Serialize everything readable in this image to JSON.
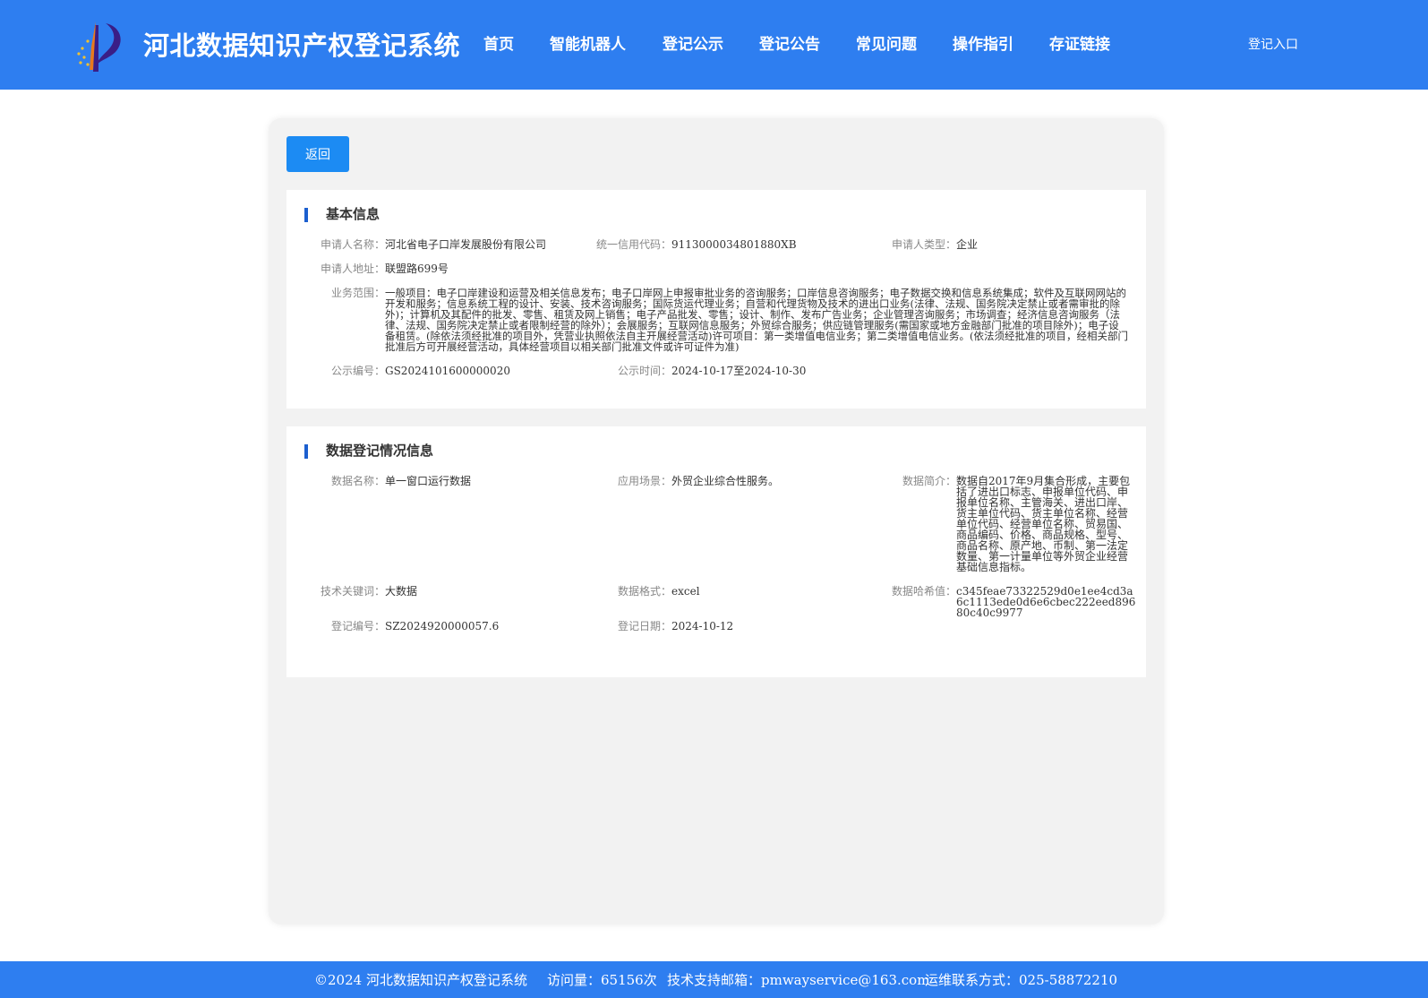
{
  "header": {
    "title": "河北数据知识产权登记系统",
    "nav": [
      "首页",
      "智能机器人",
      "登记公示",
      "登记公告",
      "常见问题",
      "操作指引",
      "存证链接"
    ],
    "login": "登记入口"
  },
  "back_label": "返回",
  "basic": {
    "title": "基本信息",
    "applicant_name_label": "申请人名称：",
    "applicant_name": "河北省电子口岸发展股份有限公司",
    "credit_code_label": "统一信用代码：",
    "credit_code": "9113000034801880XB",
    "applicant_type_label": "申请人类型：",
    "applicant_type": "企业",
    "address_label": "申请人地址：",
    "address": "联盟路699号",
    "scope_label": "业务范围：",
    "scope": "一般项目：电子口岸建设和运营及相关信息发布；电子口岸网上申报审批业务的咨询服务；口岸信息咨询服务；电子数据交换和信息系统集成；软件及互联网网站的开发和服务；信息系统工程的设计、安装、技术咨询服务；国际货运代理业务；自营和代理货物及技术的进出口业务(法律、法规、国务院决定禁止或者需审批的除外)；计算机及其配件的批发、零售、租赁及网上销售；电子产品批发、零售；设计、制作、发布广告业务；企业管理咨询服务；市场调查；经济信息咨询服务（法律、法规、国务院决定禁止或者限制经营的除外）；会展服务；互联网信息服务；外贸综合服务；供应链管理服务(需国家或地方金融部门批准的项目除外)；电子设备租赁。(除依法须经批准的项目外，凭营业执照依法自主开展经营活动)许可项目：第一类增值电信业务；第二类增值电信业务。(依法须经批准的项目，经相关部门批准后方可开展经营活动，具体经营项目以相关部门批准文件或许可证件为准)",
    "pub_no_label": "公示编号：",
    "pub_no": "GS2024101600000020",
    "pub_time_label": "公示时间：",
    "pub_time": "2024-10-17至2024-10-30"
  },
  "data_reg": {
    "title": "数据登记情况信息",
    "data_name_label": "数据名称：",
    "data_name": "单一窗口运行数据",
    "scenario_label": "应用场景：",
    "scenario": "外贸企业综合性服务。",
    "intro_label": "数据简介：",
    "intro": "数据自2017年9月集合形成，主要包括了进出口标志、申报单位代码、申报单位名称、主管海关、进出口岸、货主单位代码、货主单位名称、经营单位代码、经营单位名称、贸易国、商品编码、价格、商品规格、型号、商品名称、原产地、币制、第一法定数量、第一计量单位等外贸企业经营基础信息指标。",
    "keyword_label": "技术关键词：",
    "keyword": "大数据",
    "format_label": "数据格式：",
    "format": "excel",
    "hash_label": "数据哈希值：",
    "hash": "c345feae73322529d0e1ee4cd3a6c1113ede0d6e6cbec222eed89680c40c9977",
    "reg_no_label": "登记编号：",
    "reg_no": "SZ2024920000057.6",
    "reg_date_label": "登记日期：",
    "reg_date": "2024-10-12"
  },
  "footer": {
    "copyright": "©2024 河北数据知识产权登记系统",
    "visits": "访问量：65156次",
    "email": "技术支持邮箱：pmwayservice@163.com",
    "ops": "运维联系方式：025-58872210"
  },
  "colors": {
    "header_bg": "#2e7ef0",
    "button_bg": "#1c8bf3",
    "panel_bg": "#f2f2f2",
    "title_bar": "#1c5fcf"
  }
}
